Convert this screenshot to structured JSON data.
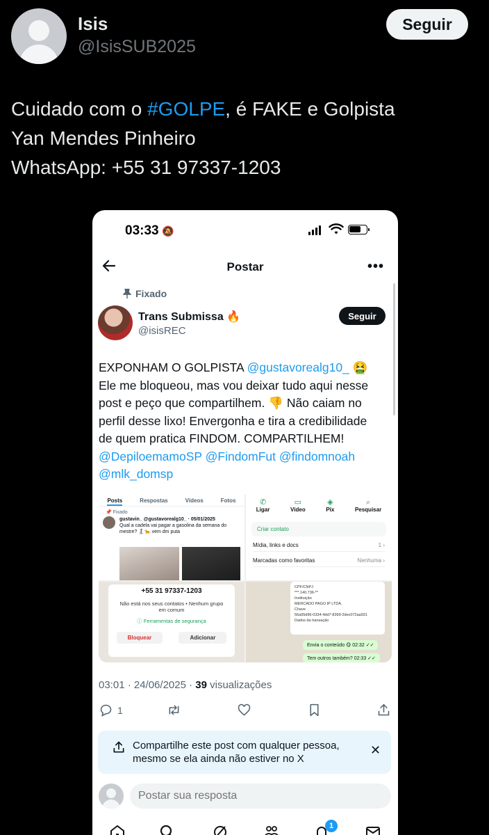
{
  "outer": {
    "name": "Isis",
    "handle": "@IsisSUB2025",
    "follow_label": "Seguir",
    "text_line1_pre": "Cuidado com o ",
    "text_hashtag": "#GOLPE",
    "text_line1_post": ", é FAKE e Golpista",
    "text_line2": "Yan Mendes Pinheiro",
    "text_line3": "WhatsApp: +55 31 97337-1203"
  },
  "phone": {
    "status_time": "03:33",
    "page_title": "Postar",
    "pinned_label": "Fixado",
    "author_name": "Trans Submissa 🔥",
    "author_handle": "@isisREC",
    "follow_label": "Seguir",
    "text_l1_pre": "EXPONHAM O GOLPISTA ",
    "text_l1_mention": "@gustavorealg10_",
    "text_l1_post": " 🤮",
    "text_l2": "Ele me bloqueou, mas vou deixar tudo aqui nesse",
    "text_l3": "post e peço que compartilhem. 👎 Não caiam no",
    "text_l4": "perfil desse lixo! Envergonha e tira a credibilidade",
    "text_l5": "de quem pratica FINDOM. COMPARTILHEM!",
    "text_l6": "@DepiloemamoSP @FindomFut @findomnoah",
    "text_l7": "@mlk_domsp",
    "media": {
      "tabs": [
        "Posts",
        "Respostas",
        "Vídeos",
        "Fotos"
      ],
      "pinned": "📌 Fixado",
      "tweet_head": "gustavin_ @gustavorealg10_ · 05/01/2025",
      "tweet_body": "Qual a cadela vai pagar a gasolina da semana do mestre? 🧎‍♀️🐆 vem dm puta",
      "wa_actions": [
        "Ligar",
        "Vídeo",
        "Pix",
        "Pesquisar"
      ],
      "wa_contact": "Criar contato",
      "wa_media": "Mídia, links e docs",
      "wa_media_count": "1 ›",
      "wa_fav": "Marcadas como favoritas",
      "wa_fav_value": "Nenhuma ›",
      "contact_number": "+55 31 97337-1203",
      "contact_info": "Não está nos seus contatos • Nenhum grupo em comum",
      "contact_sec": "ⓘ Ferramentas de segurança",
      "contact_block": "Bloquear",
      "contact_add": "Adicionar",
      "pix_l1": "CPF/CNPJ",
      "pix_l2": "***.140.736-**",
      "pix_l3": "Instituição",
      "pix_l4": "MERCADO PAGO IP LTDA.",
      "pix_l5": "Chave",
      "pix_l6": "56a95d96-0334-4dd7-8399-2dec072aa931",
      "pix_l7": "Dados da transação",
      "chat1": "Envia o conteúdo 😋  02:32 ✓✓",
      "chat2": "Tem outros também?  02:33 ✓✓"
    },
    "meta_time": "03:01 · 24/06/2025 · ",
    "meta_views_count": "39",
    "meta_views_label": " visualizações",
    "reply_count": "1",
    "share_line1": "Compartilhe este post com qualquer pessoa,",
    "share_line2": "mesmo se ela ainda não estiver no X",
    "reply_placeholder": "Postar sua resposta",
    "notif_badge": "1"
  },
  "colors": {
    "accent": "#1d9bf0",
    "background": "#000000",
    "phone_bg": "#ffffff"
  },
  "icons": [
    "back-arrow-icon",
    "more-icon",
    "pin-icon",
    "reply-icon",
    "repost-icon",
    "like-icon",
    "bookmark-icon",
    "share-icon",
    "close-icon",
    "home-icon",
    "search-icon",
    "grok-icon",
    "communities-icon",
    "notifications-icon",
    "messages-icon"
  ]
}
